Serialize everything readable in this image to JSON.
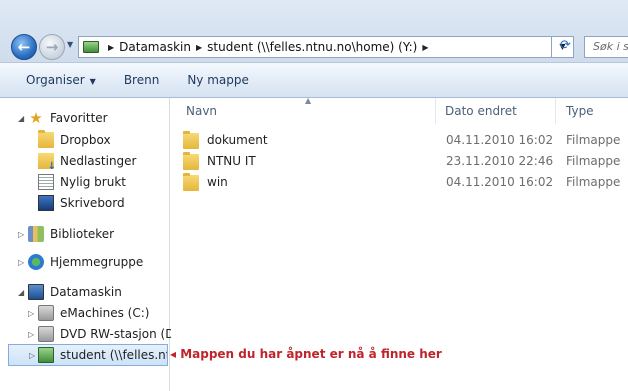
{
  "address_bar": {
    "crumbs": [
      "Datamaskin",
      "student (\\\\felles.ntnu.no\\home) (Y:)"
    ],
    "search_placeholder": "Søk i stu"
  },
  "commands": [
    {
      "label": "Organiser",
      "has_caret": true
    },
    {
      "label": "Brenn",
      "has_caret": false
    },
    {
      "label": "Ny mappe",
      "has_caret": false
    }
  ],
  "nav": {
    "favorites": {
      "label": "Favoritter",
      "items": [
        "Dropbox",
        "Nedlastinger",
        "Nylig brukt",
        "Skrivebord"
      ]
    },
    "libraries": "Biblioteker",
    "homegroup": "Hjemmegruppe",
    "computer": {
      "label": "Datamaskin",
      "items": [
        "eMachines (C:)",
        "DVD RW-stasjon (D:)",
        "student (\\\\felles.ntnu"
      ]
    }
  },
  "columns": {
    "name": "Navn",
    "date": "Dato endret",
    "type": "Type"
  },
  "files": [
    {
      "name": "dokument",
      "date": "04.11.2010 16:02",
      "type": "Filmappe"
    },
    {
      "name": "NTNU IT",
      "date": "23.11.2010 22:46",
      "type": "Filmappe"
    },
    {
      "name": "win",
      "date": "04.11.2010 16:02",
      "type": "Filmappe"
    }
  ],
  "annotation": "Mappen du har åpnet er nå å finne her",
  "colors": {
    "annotation": "#c0242b",
    "command_text": "#1e395b",
    "header_text": "#4c607a"
  }
}
